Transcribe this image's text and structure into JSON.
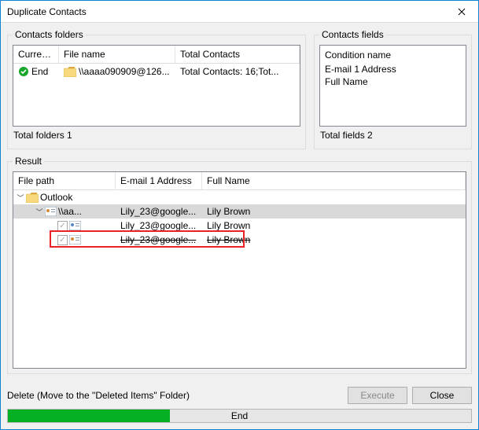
{
  "window": {
    "title": "Duplicate Contacts"
  },
  "folders": {
    "legend": "Contacts folders",
    "headers": {
      "current": "Curren...",
      "file": "File name",
      "total": "Total Contacts"
    },
    "row": {
      "current": "End",
      "file": "\\\\aaaa090909@126...",
      "total": "Total Contacts: 16;Tot..."
    },
    "summary": "Total folders  1"
  },
  "fields": {
    "legend": "Contacts fields",
    "header": "Condition name",
    "items": [
      "E-mail 1 Address",
      "Full Name"
    ],
    "summary": "Total fields  2"
  },
  "result": {
    "legend": "Result",
    "headers": {
      "path": "File path",
      "email": "E-mail 1 Address",
      "name": "Full Name"
    },
    "tree": {
      "root": "Outlook",
      "group": "\\\\aa...",
      "rows": [
        {
          "email": "Lily_23@google...",
          "name": "Lily Brown"
        },
        {
          "email": "Lily_23@google...",
          "name": "Lily Brown"
        },
        {
          "email": "Lily_23@google...",
          "name": "Lily Brown"
        }
      ]
    }
  },
  "footer": {
    "label": "Delete (Move to the \"Deleted Items\" Folder)",
    "execute": "Execute",
    "close": "Close",
    "progress_text": "End",
    "progress_pct": 35
  }
}
